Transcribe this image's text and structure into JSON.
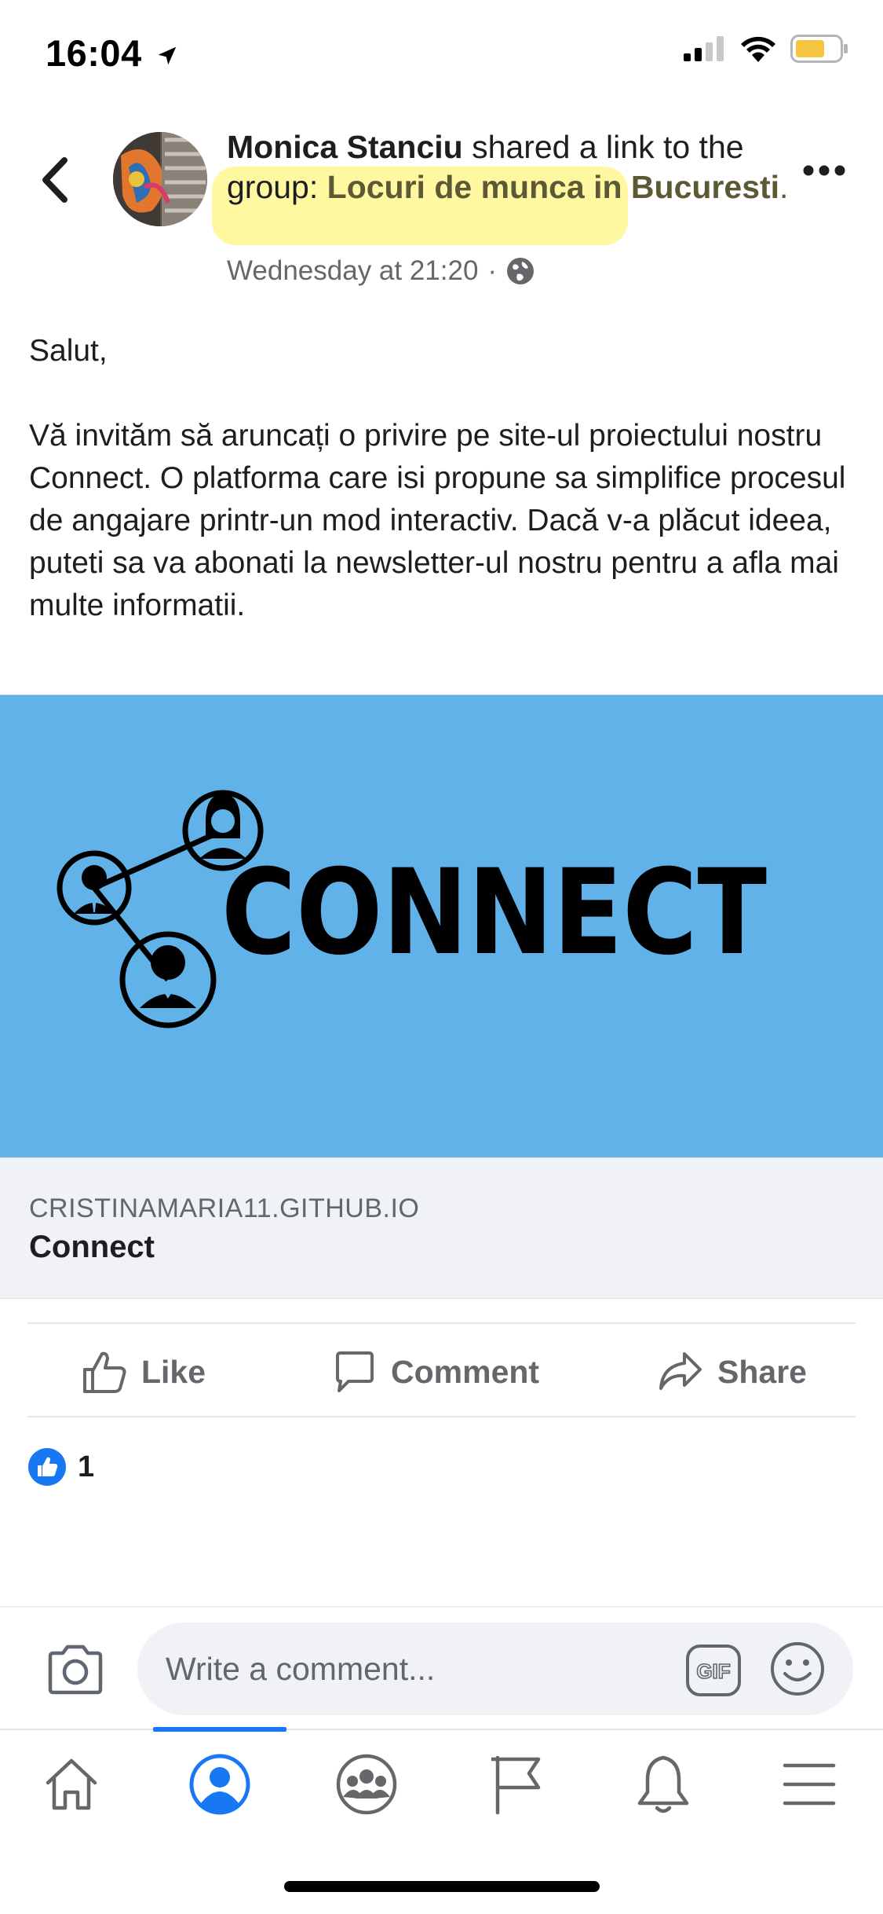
{
  "status_bar": {
    "time": "16:04",
    "icons": [
      "location-arrow-icon",
      "signal-icon",
      "wifi-icon",
      "battery-icon"
    ]
  },
  "post": {
    "author": "Monica Stanciu",
    "action_text": " shared a link to the group: ",
    "group_name": "Locuri de munca in Bucuresti",
    "period": ".",
    "timestamp": "Wednesday at 21:20",
    "separator": "·",
    "privacy_icon": "globe-icon",
    "greeting": "Salut,",
    "body": "Vă invităm să aruncați o privire pe site-ul proiectului nostru Connect. O platforma care isi propune sa simplifice procesul de angajare printr-un mod interactiv. Dacă v-a plăcut ideea, puteti sa va abonati la newsletter-ul nostru pentru a afla mai multe informatii."
  },
  "link_preview": {
    "image_logo_text": "CONNECT",
    "domain": "CRISTINAMARIA11.GITHUB.IO",
    "title": "Connect",
    "background_color": "#62b2ea"
  },
  "actions": {
    "like": "Like",
    "comment": "Comment",
    "share": "Share"
  },
  "reactions": {
    "count": "1",
    "icon": "like-reaction-icon"
  },
  "comment_bar": {
    "placeholder": "Write a comment...",
    "gif_label": "GIF"
  },
  "tabs": [
    {
      "name": "home",
      "icon": "home-icon",
      "active": false
    },
    {
      "name": "profile",
      "icon": "profile-icon",
      "active": true
    },
    {
      "name": "groups",
      "icon": "groups-icon",
      "active": false
    },
    {
      "name": "pages",
      "icon": "flag-icon",
      "active": false
    },
    {
      "name": "notifications",
      "icon": "bell-icon",
      "active": false
    },
    {
      "name": "menu",
      "icon": "menu-icon",
      "active": false
    }
  ],
  "colors": {
    "accent": "#1877f2",
    "highlight": "#fff56e",
    "text_secondary": "#65676b"
  }
}
